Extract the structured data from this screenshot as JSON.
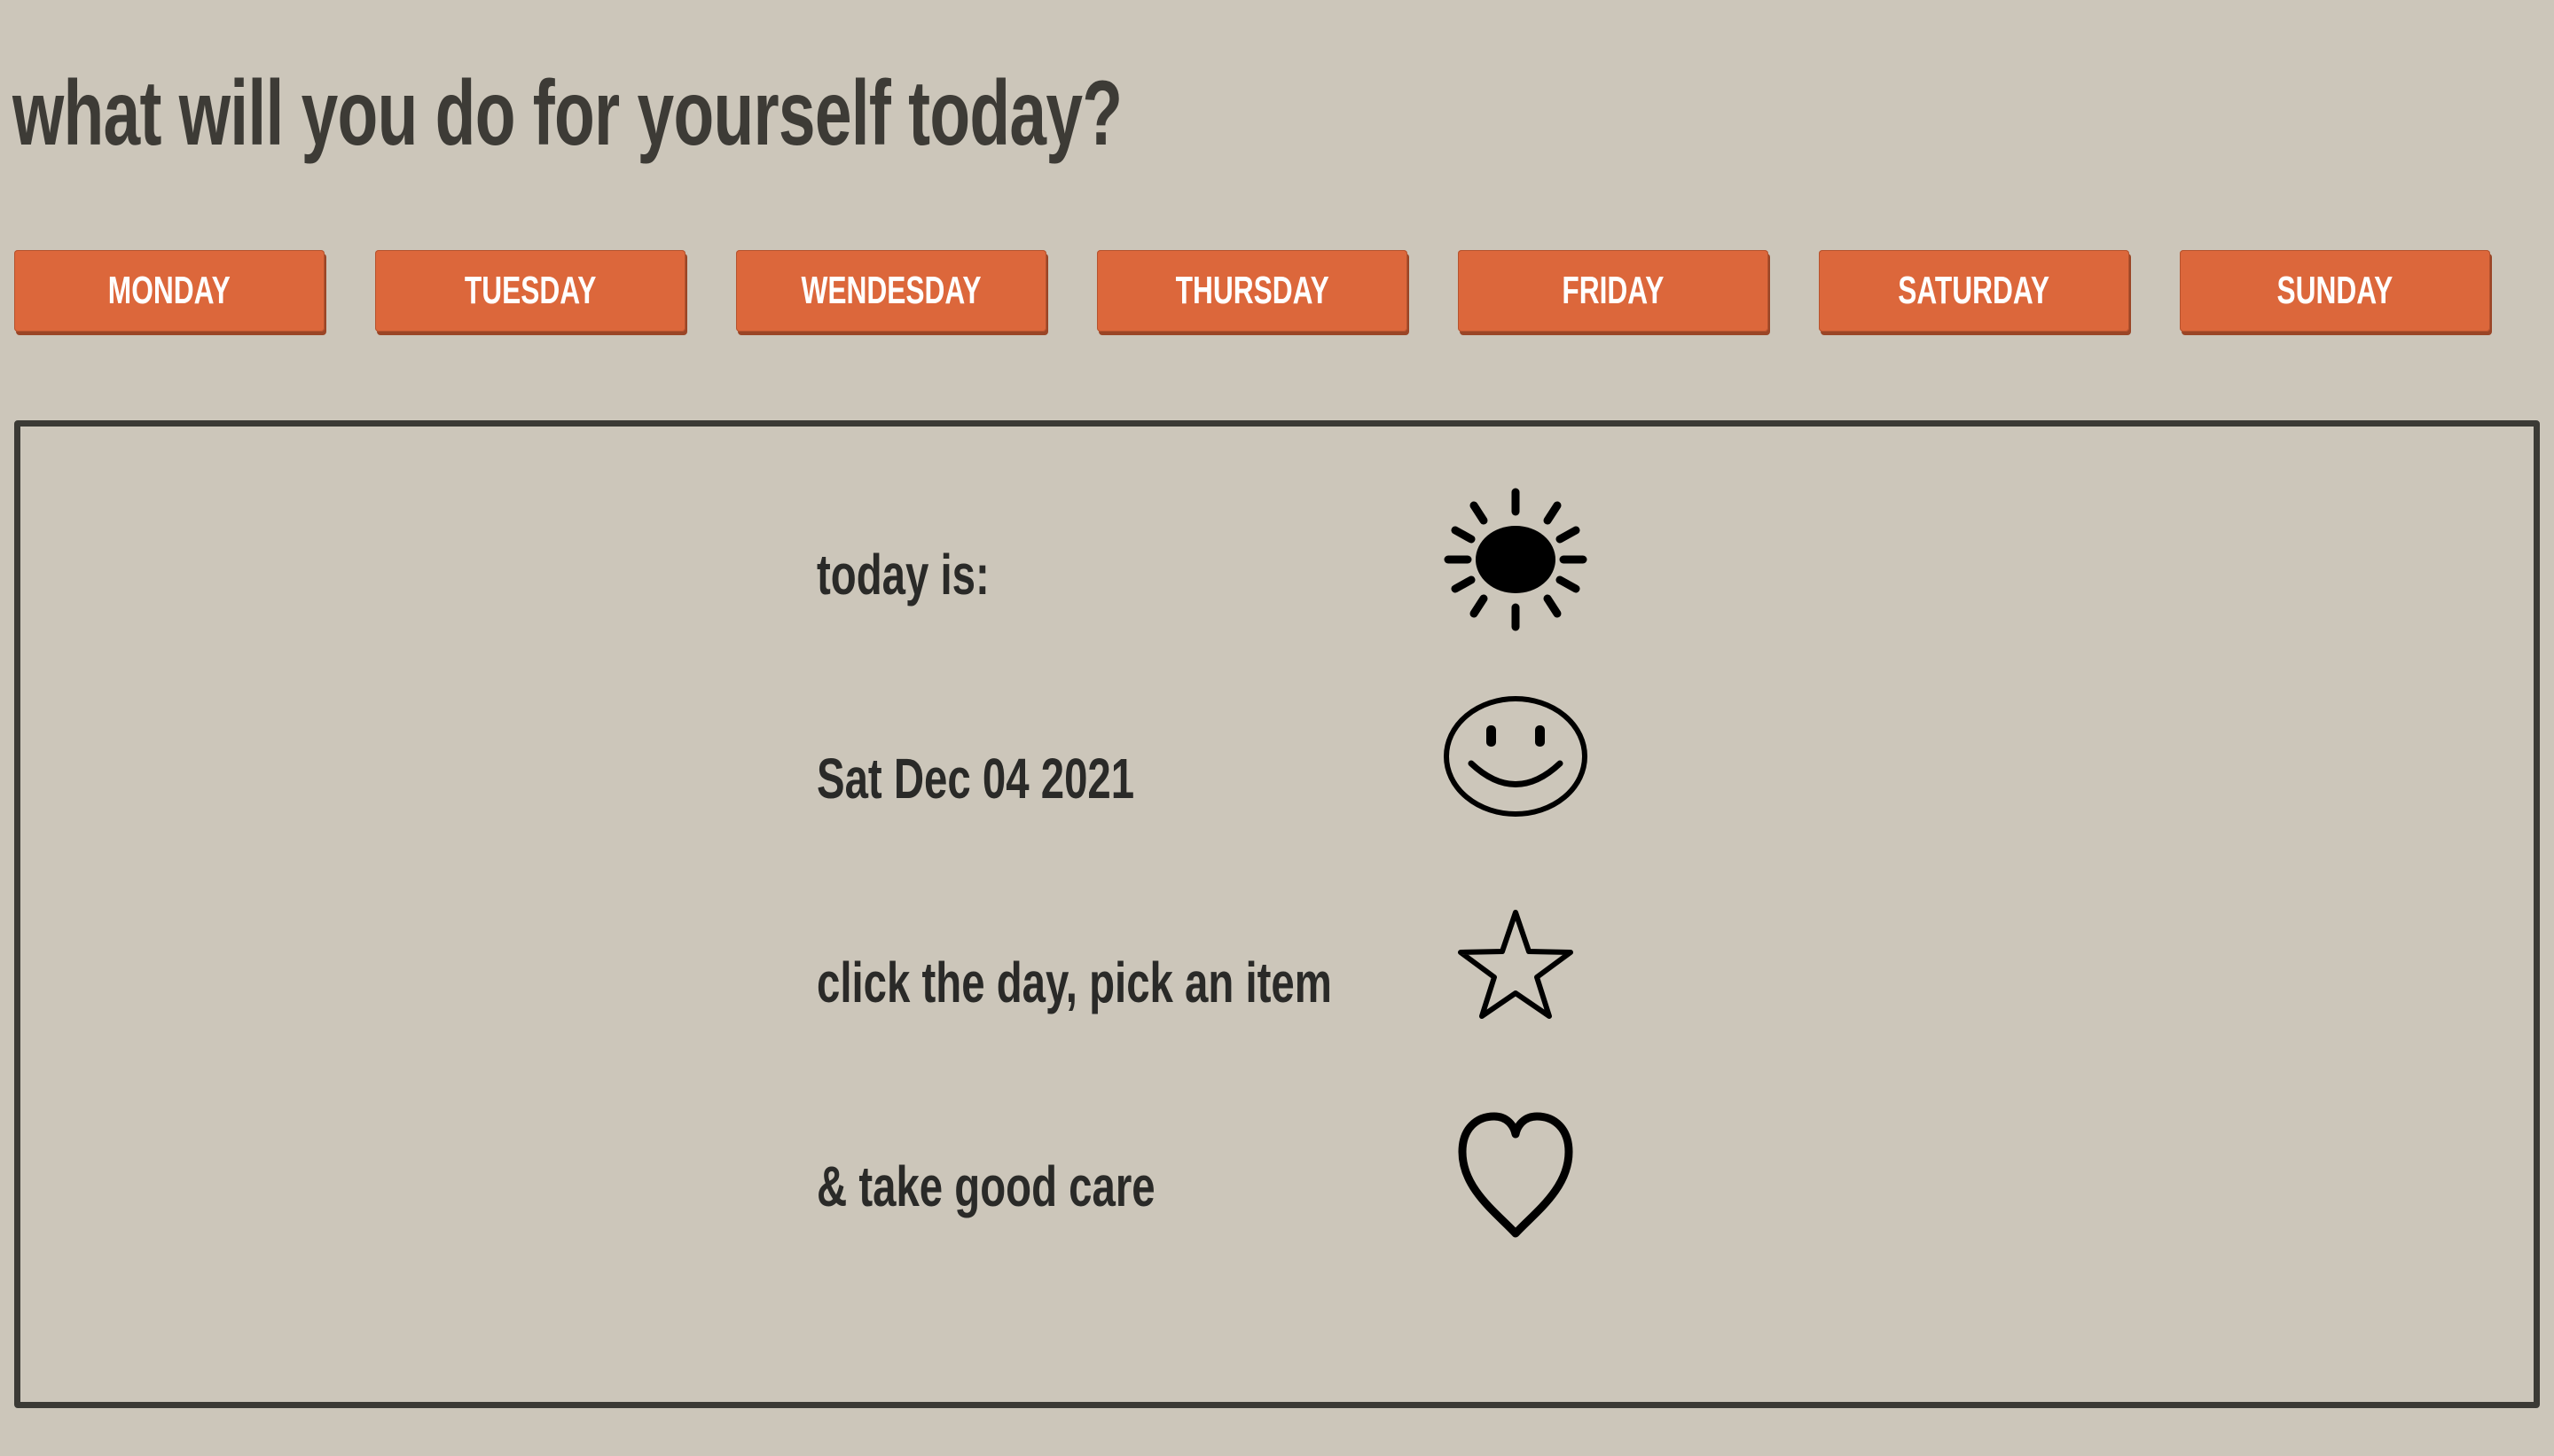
{
  "header": {
    "title": "what will you do for yourself today?"
  },
  "days": [
    {
      "label": "MONDAY"
    },
    {
      "label": "TUESDAY"
    },
    {
      "label": "WENDESDAY"
    },
    {
      "label": "THURSDAY"
    },
    {
      "label": "FRIDAY"
    },
    {
      "label": "SATURDAY"
    },
    {
      "label": "SUNDAY"
    }
  ],
  "panel": {
    "rows": [
      {
        "text": "today is:",
        "icon": "sun-icon"
      },
      {
        "text": "Sat Dec 04 2021",
        "icon": "smiley-icon"
      },
      {
        "text": "click the day, pick an item",
        "icon": "star-icon"
      },
      {
        "text": "& take good care",
        "icon": "heart-icon"
      }
    ]
  },
  "colors": {
    "background": "#ccc6ba",
    "accent": "#dc673b",
    "text": "#3b3a35"
  }
}
